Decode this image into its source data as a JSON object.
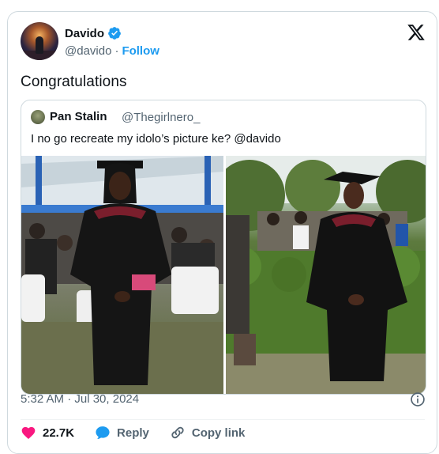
{
  "author": {
    "display_name": "Davido",
    "handle": "@davido",
    "separator": "·",
    "follow_label": "Follow"
  },
  "tweet": {
    "text": "Congratulations",
    "timestamp": "5:32 AM · Jul 30, 2024"
  },
  "quoted": {
    "display_name": "Pan Stalin",
    "handle": "@Thegirlnero_",
    "text": "I no go recreate my idolo’s picture ke? @davido"
  },
  "actions": {
    "likes": "22.7K",
    "reply_label": "Reply",
    "copy_label": "Copy link"
  },
  "colors": {
    "like": "#f91880",
    "reply": "#1d9bf0",
    "accent": "#1d9bf0",
    "muted": "#536471"
  },
  "icons": [
    "verified-badge-icon",
    "x-logo-icon",
    "info-icon",
    "heart-icon",
    "reply-bubble-icon",
    "link-icon"
  ]
}
